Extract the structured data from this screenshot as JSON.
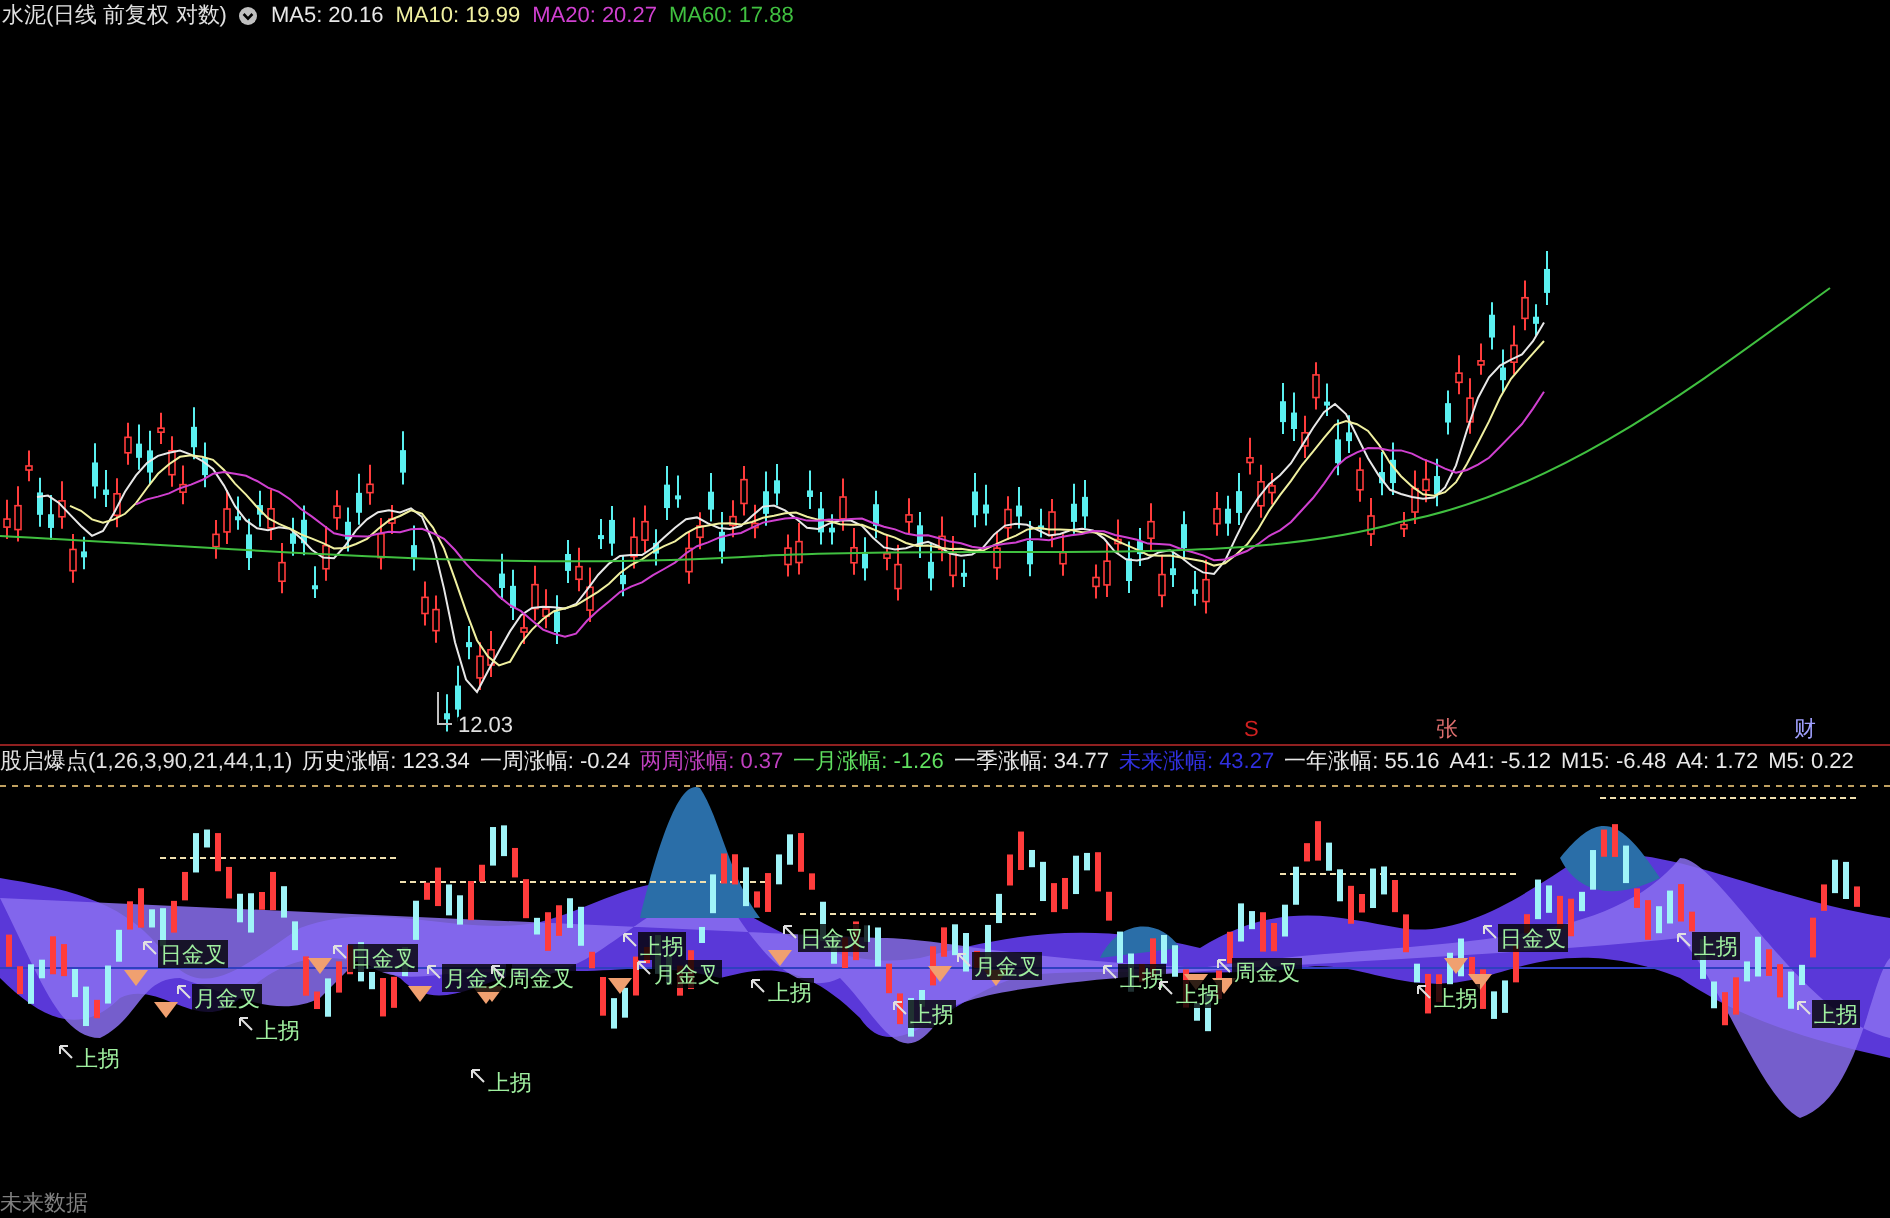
{
  "chart_header": {
    "title": "水泥(日线 前复权 对数)",
    "ma_legend": [
      {
        "label": "MA5: 20.16",
        "color": "#e8e8e8"
      },
      {
        "label": "MA10: 19.99",
        "color": "#f0f0a0"
      },
      {
        "label": "MA20: 20.27",
        "color": "#d040d0"
      },
      {
        "label": "MA60: 17.88",
        "color": "#40c040"
      }
    ]
  },
  "price_chart": {
    "low_label": "12.03"
  },
  "event_markers": [
    {
      "text": "S",
      "color": "#d02020"
    },
    {
      "text": "张",
      "color": "#e07070"
    },
    {
      "text": "财",
      "color": "#a0a0ff"
    }
  ],
  "indicator": {
    "name": "股启爆点(1,26,3,90,21,44,1,1)",
    "stats": [
      {
        "label": "历史涨幅: 123.34",
        "color": "#e8e8e8"
      },
      {
        "label": "一周涨幅: -0.24",
        "color": "#e8e8e8"
      },
      {
        "label": "两周涨幅: 0.37",
        "color": "#c040c0"
      },
      {
        "label": "一月涨幅: -1.26",
        "color": "#60e060"
      },
      {
        "label": "一季涨幅: 34.77",
        "color": "#e8e8e8"
      },
      {
        "label": "未来涨幅: 43.27",
        "color": "#3030e0"
      },
      {
        "label": "一年涨幅: 55.16",
        "color": "#e8e8e8"
      },
      {
        "label": "A41: -5.12",
        "color": "#e8e8e8"
      },
      {
        "label": "M15: -6.48",
        "color": "#e8e8e8"
      },
      {
        "label": "A4: 1.72",
        "color": "#e8e8e8"
      },
      {
        "label": "M5: 0.22",
        "color": "#e8e8e8"
      }
    ],
    "signals": [
      {
        "text": "日金叉"
      },
      {
        "text": "月金叉"
      },
      {
        "text": "上拐"
      },
      {
        "text": "上拐"
      },
      {
        "text": "日金叉"
      },
      {
        "text": "月金叉"
      },
      {
        "text": "周金叉"
      },
      {
        "text": "上拐"
      },
      {
        "text": "上拐"
      },
      {
        "text": "月金叉"
      },
      {
        "text": "日金叉"
      },
      {
        "text": "上拐"
      },
      {
        "text": "上拐"
      },
      {
        "text": "月金叉"
      },
      {
        "text": "上拐"
      },
      {
        "text": "上拐"
      },
      {
        "text": "周金叉"
      },
      {
        "text": "上拐"
      },
      {
        "text": "日金叉"
      },
      {
        "text": "上拐"
      },
      {
        "text": "上拐"
      }
    ]
  },
  "footer": {
    "text": "未来数据"
  }
}
